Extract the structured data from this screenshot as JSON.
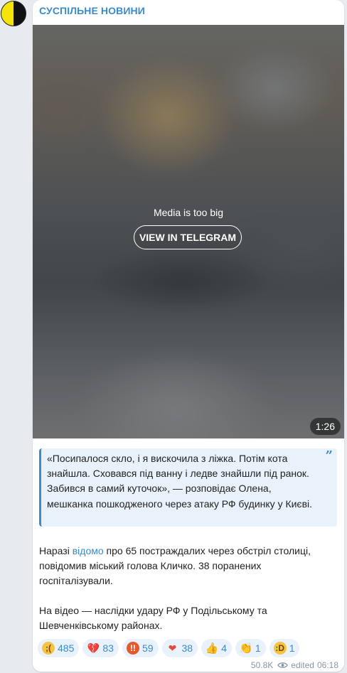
{
  "channel": {
    "name": "СУСПІЛЬНЕ НОВИНИ",
    "avatar_colors": [
      "#f5e409",
      "#111111"
    ],
    "accent_color": "#3a8bc9"
  },
  "media": {
    "message": "Media is too big",
    "button_label": "VIEW IN TELEGRAM",
    "duration": "1:26"
  },
  "quote": {
    "text": "«Посипалося скло, і я вискочила з ліжка. Потім кота знайшла. Сховався під ванну і ледве знайшли під ранок. Забився в самий куточок», — розповідає Олена, мешканка пошкодженого через атаку РФ будинку у Києві.",
    "icon": "quote-icon"
  },
  "body": {
    "p1_prefix": "Наразі ",
    "p1_link": "відомо",
    "p1_suffix": " про 65 постраждалих через обстріл столиці, повідомив міський голова Кличко. 38 поранених госпіталізували.",
    "p2": "На відео — наслідки удару РФ у Подільському та Шевченківському районах."
  },
  "reactions": [
    {
      "icon": "crying-face-icon",
      "glyph": ";(",
      "count": "485"
    },
    {
      "icon": "broken-heart-icon",
      "glyph": "💔",
      "count": "83"
    },
    {
      "icon": "angry-face-icon",
      "glyph": "!!",
      "count": "59"
    },
    {
      "icon": "heart-icon",
      "glyph": "❤",
      "count": "38"
    },
    {
      "icon": "thumbs-up-icon",
      "glyph": "👍",
      "count": "4"
    },
    {
      "icon": "clapping-hands-icon",
      "glyph": "👏",
      "count": "1"
    },
    {
      "icon": "grinning-face-icon",
      "glyph": ":D",
      "count": "1"
    }
  ],
  "meta": {
    "views": "50.8K",
    "edited_label": "edited",
    "time": "06:18"
  }
}
